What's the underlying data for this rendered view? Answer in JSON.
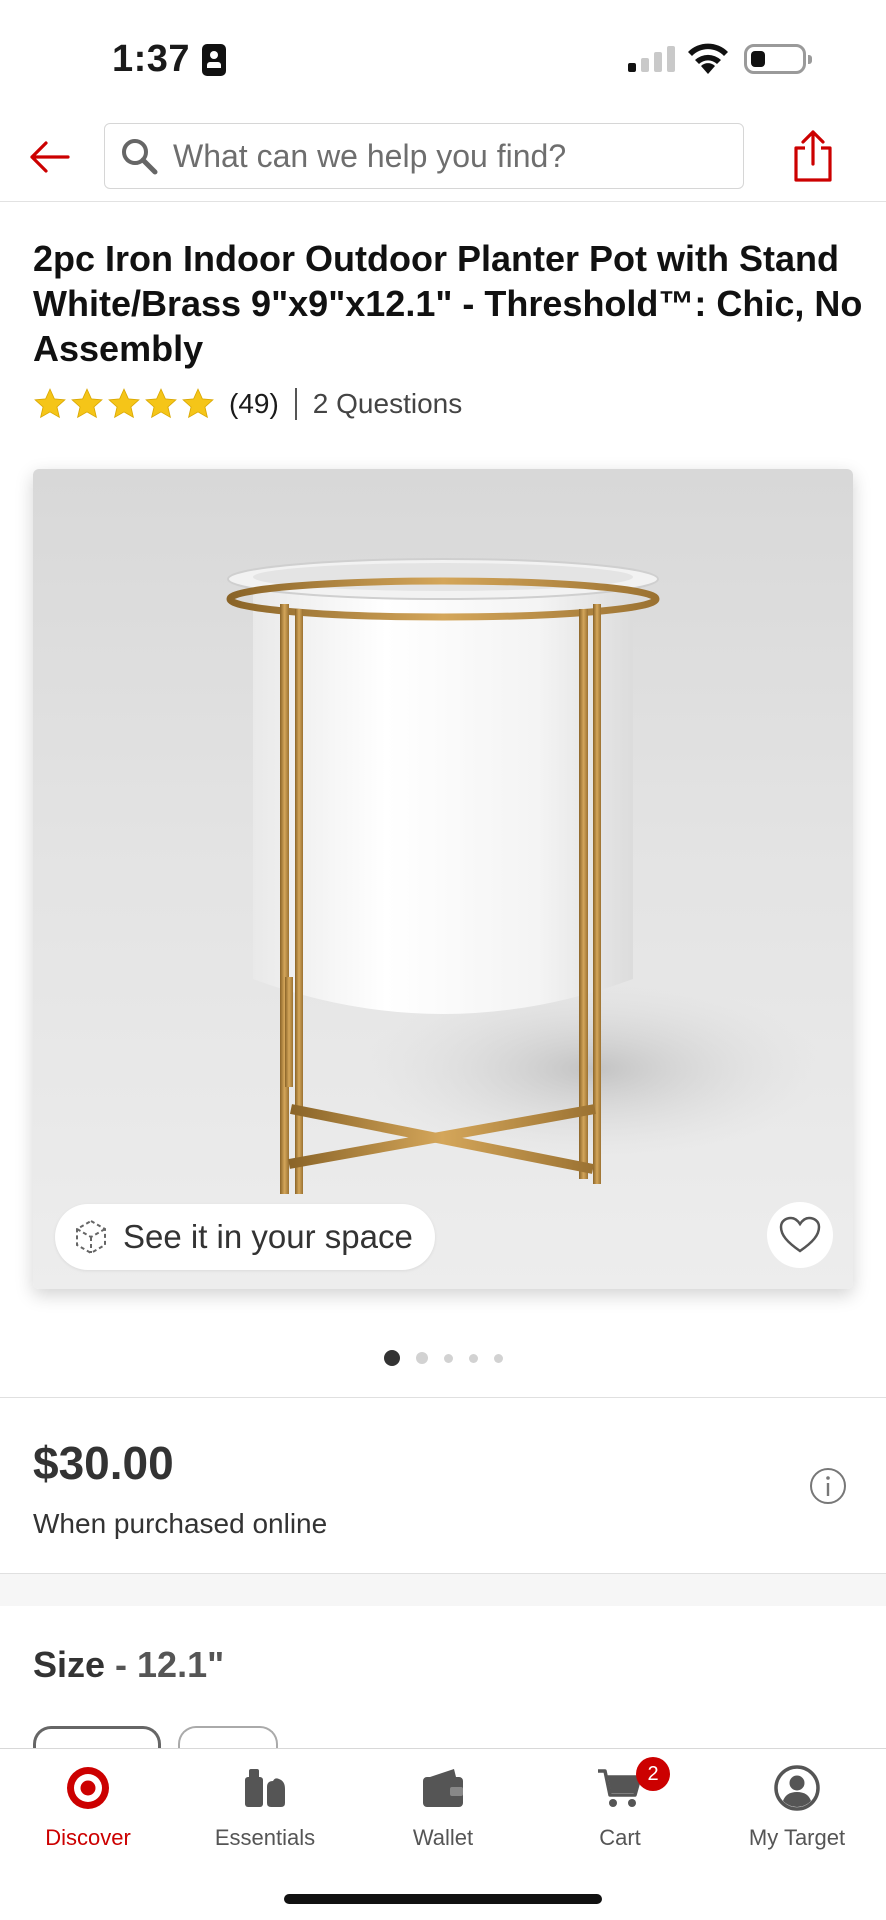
{
  "status_bar": {
    "time": "1:37"
  },
  "header": {
    "search_placeholder": "What can we help you find?",
    "icons": {
      "back": "back-arrow-icon",
      "search": "search-icon",
      "share": "share-icon"
    }
  },
  "product": {
    "title": "2pc Iron Indoor Outdoor Planter Pot with Stand White/Brass 9\"x9\"x12.1\" - Threshold™: Chic, No Assembly",
    "rating_stars": 5,
    "review_count": "(49)",
    "questions": "2 Questions",
    "ar_label": "See it in your space",
    "carousel": {
      "total": 5,
      "active": 1
    },
    "price": "$30.00",
    "price_note": "When purchased online",
    "size_label": "Size",
    "size_value": " - 12.1\""
  },
  "bottom_nav": {
    "items": [
      {
        "label": "Discover",
        "icon": "target-bullseye-icon",
        "active": true
      },
      {
        "label": "Essentials",
        "icon": "essentials-icon"
      },
      {
        "label": "Wallet",
        "icon": "wallet-icon"
      },
      {
        "label": "Cart",
        "icon": "cart-icon",
        "badge": "2"
      },
      {
        "label": "My Target",
        "icon": "account-icon"
      }
    ]
  },
  "colors": {
    "brand_red": "#cc0000",
    "star_gold": "#f5c518",
    "text_dark": "#333333"
  }
}
